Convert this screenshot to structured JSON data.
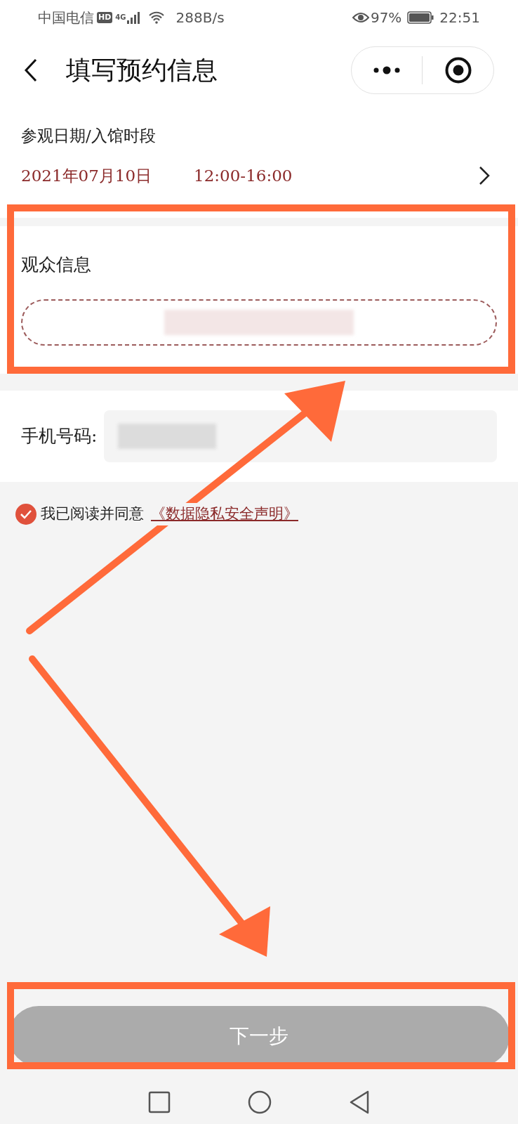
{
  "status_bar": {
    "carrier": "中国电信",
    "hd": "HD",
    "network": "4G",
    "speed": "288B/s",
    "battery": "97%",
    "time": "22:51"
  },
  "nav": {
    "title": "填写预约信息"
  },
  "visit": {
    "label": "参观日期/入馆时段",
    "date": "2021年07月10日",
    "slot": "12:00-16:00"
  },
  "audience": {
    "label": "观众信息"
  },
  "phone": {
    "label": "手机号码:"
  },
  "agreement": {
    "checked": true,
    "text": "我已阅读并同意",
    "link": "《数据隐私安全声明》"
  },
  "next_button": {
    "label": "下一步",
    "disabled": true
  }
}
